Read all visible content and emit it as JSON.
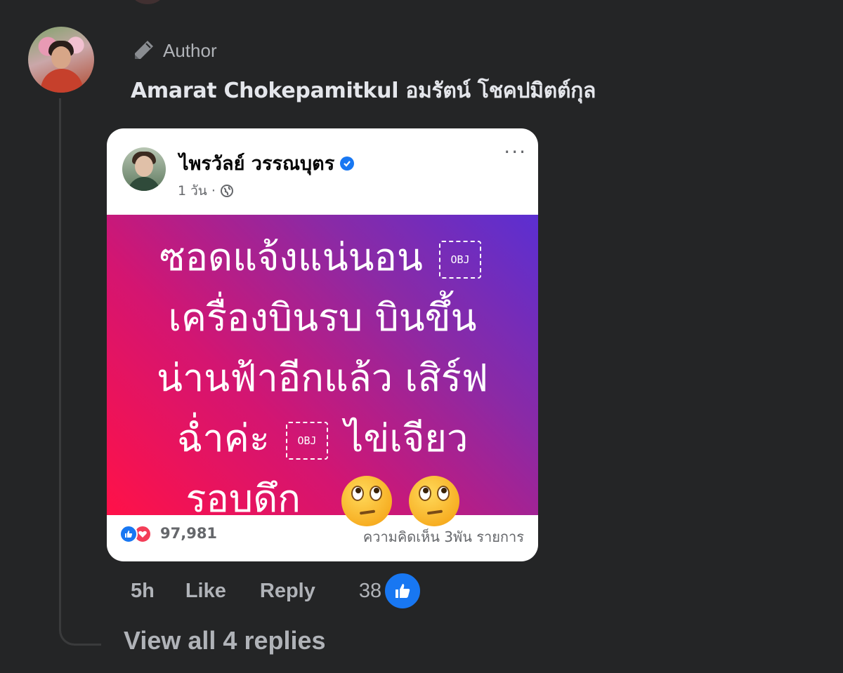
{
  "comment": {
    "badge_label": "Author",
    "badge_icon": "pencil-icon",
    "commenter_name": "Amarat Chokepamitkul อมรัตน์ โชคปมิตต์กุล",
    "shared_post": {
      "author_name": "ไพรวัลย์ วรรณบุตร",
      "verified": true,
      "meta_time": "1 วัน ·",
      "privacy_icon": "globe-icon",
      "more_icon": "more-options-icon",
      "more_label": "···",
      "image_text_lines": [
        "ซอดแจ้งแน่นอน",
        "เครื่องบินรบ บินขึ้น",
        "น่านฟ้าอีกแล้ว เสิร์ฟ",
        "ฉ่ำค่ะ",
        "ไข่เจียว",
        "รอบดึก"
      ],
      "obj_placeholder": "OBJ",
      "emoji": [
        "face-with-rolling-eyes",
        "face-with-rolling-eyes"
      ],
      "gradient_colors": [
        "#ff1148",
        "#5b2fd1"
      ],
      "reaction_count": "97,981",
      "comment_count": "ความคิดเห็น 3พัน รายการ"
    },
    "actions": {
      "time": "5h",
      "like": "Like",
      "reply": "Reply",
      "like_count": "38"
    },
    "view_replies": "View all 4 replies"
  },
  "colors": {
    "background": "#242526",
    "primary_text": "#e4e6eb",
    "secondary_text": "#b0b3b8",
    "like_blue": "#1877f2",
    "love_red": "#f33e58"
  }
}
